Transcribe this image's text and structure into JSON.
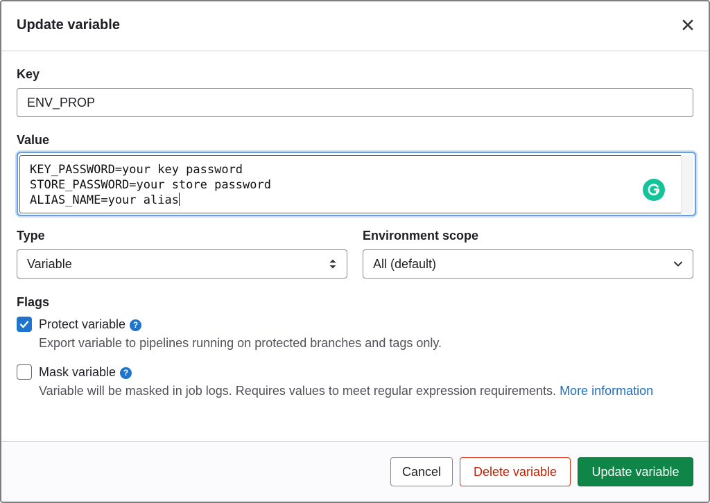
{
  "dialog": {
    "title": "Update variable"
  },
  "key": {
    "label": "Key",
    "value": "ENV_PROP"
  },
  "value": {
    "label": "Value",
    "lines": [
      "KEY_PASSWORD=your key password",
      "STORE_PASSWORD=your store password",
      "ALIAS_NAME=your alias"
    ]
  },
  "type": {
    "label": "Type",
    "selected": "Variable"
  },
  "environment_scope": {
    "label": "Environment scope",
    "selected": "All (default)"
  },
  "flags": {
    "label": "Flags",
    "protect": {
      "label": "Protect variable",
      "checked": true,
      "help": "Export variable to pipelines running on protected branches and tags only."
    },
    "mask": {
      "label": "Mask variable",
      "checked": false,
      "help": "Variable will be masked in job logs. Requires values to meet regular expression requirements.",
      "link_text": "More information"
    }
  },
  "footer": {
    "cancel_label": "Cancel",
    "delete_label": "Delete variable",
    "update_label": "Update variable"
  },
  "colors": {
    "primary_blue": "#1f75cb",
    "confirm_green": "#108548",
    "danger_red": "#dd2b0e",
    "grammarly_green": "#15c39a"
  },
  "icons": {
    "close": "close-icon",
    "grammarly": "grammarly-icon",
    "select_arrows": "chevron-up-down-icon",
    "dropdown": "chevron-down-icon",
    "help": "question-circle-icon",
    "check": "check-icon"
  }
}
